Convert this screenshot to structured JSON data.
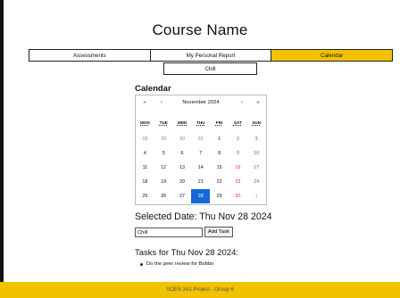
{
  "page": {
    "title": "Course Name"
  },
  "tabs": [
    {
      "label": "Assessments",
      "active": false
    },
    {
      "label": "My Personal Report",
      "active": false
    },
    {
      "label": "Calendar",
      "active": true
    }
  ],
  "subtab": {
    "label": "Chill"
  },
  "calendar": {
    "heading": "Calendar",
    "nav": {
      "prev_year": "«",
      "prev_month": "‹",
      "month_label": "November 2024",
      "next_month": "›",
      "next_year": "»"
    },
    "weekdays": [
      "MON",
      "TUE",
      "WED",
      "THU",
      "FRI",
      "SAT",
      "SUN"
    ],
    "weeks": [
      [
        "28",
        "29",
        "30",
        "31",
        "1",
        "2",
        "3"
      ],
      [
        "4",
        "5",
        "6",
        "7",
        "8",
        "9",
        "10"
      ],
      [
        "11",
        "12",
        "13",
        "14",
        "15",
        "16",
        "17"
      ],
      [
        "18",
        "19",
        "20",
        "21",
        "22",
        "23",
        "24"
      ],
      [
        "25",
        "26",
        "27",
        "28",
        "29",
        "30",
        "1"
      ]
    ],
    "selected_day": "28"
  },
  "selected": {
    "label": "Selected Date: Thu Nov 28 2024"
  },
  "task_form": {
    "input_value": "Chill",
    "button_label": "Add Task"
  },
  "tasks": {
    "heading": "Tasks for Thu Nov 28 2024:",
    "items": [
      "Do the peer review for Bobbo"
    ]
  },
  "footer": {
    "text": "SOEN 341 Project - Group 6"
  },
  "colors": {
    "accent": "#f2c200",
    "selected_day": "#1668d8",
    "weekend": "#d33333"
  }
}
